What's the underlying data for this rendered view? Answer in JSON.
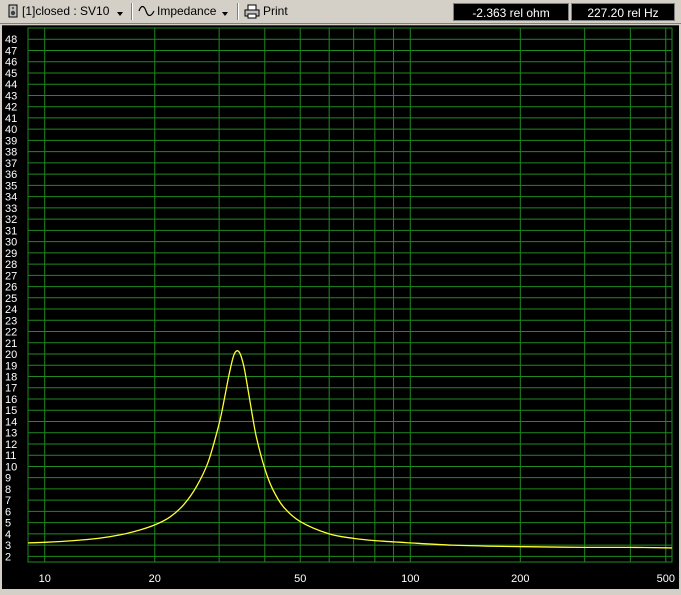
{
  "toolbar": {
    "curve_selector": "[1]closed : SV10",
    "mode_selector": "Impedance",
    "print_label": "Print",
    "readout_value": "-2.363 rel ohm",
    "readout_freq": "227.20 rel Hz"
  },
  "icons": {
    "curve": "speaker-box-icon",
    "mode": "sine-wave-icon",
    "print": "printer-icon"
  },
  "colors": {
    "plot_background": "#000000",
    "grid": "#1f8a1f",
    "curve": "#ffff33",
    "axis_text": "#ffffff"
  },
  "chart_data": {
    "type": "line",
    "x_scale": "log",
    "xlim": [
      9,
      520
    ],
    "ylim": [
      1.5,
      49
    ],
    "x_ticks": [
      10,
      20,
      50,
      100,
      200,
      500
    ],
    "y_ticks": [
      2,
      3,
      4,
      5,
      6,
      7,
      8,
      9,
      10,
      11,
      12,
      13,
      14,
      15,
      16,
      17,
      18,
      19,
      20,
      21,
      22,
      23,
      24,
      25,
      26,
      27,
      28,
      29,
      30,
      31,
      32,
      33,
      34,
      35,
      36,
      37,
      38,
      39,
      40,
      41,
      42,
      43,
      44,
      45,
      46,
      47,
      48
    ],
    "series": [
      {
        "x": [
          9,
          10,
          12,
          14,
          16,
          18,
          20,
          22,
          24,
          26,
          28,
          30,
          31,
          32,
          33,
          34,
          35,
          36,
          37,
          38,
          40,
          42,
          45,
          50,
          60,
          70,
          80,
          100,
          130,
          170,
          220,
          300,
          400,
          520
        ],
        "y": [
          3.2,
          3.25,
          3.4,
          3.6,
          3.9,
          4.3,
          4.8,
          5.5,
          6.6,
          8.2,
          10.4,
          13.8,
          16.0,
          18.3,
          20.0,
          20.2,
          19.0,
          16.8,
          14.5,
          12.5,
          9.8,
          8.0,
          6.4,
          5.1,
          4.0,
          3.6,
          3.4,
          3.2,
          3.0,
          2.9,
          2.85,
          2.8,
          2.8,
          2.75
        ]
      }
    ]
  }
}
